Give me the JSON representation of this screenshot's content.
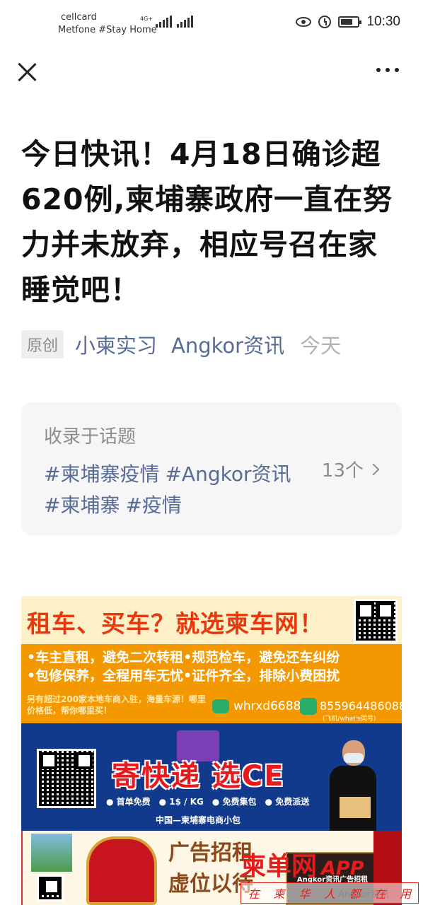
{
  "status_bar": {
    "carrier_line1": "cellcard",
    "carrier_line2": "Metfone #Stay Home",
    "network_label": "4G+",
    "time": "10:30"
  },
  "nav": {
    "close_icon": "close-icon",
    "more_icon": "more-icon"
  },
  "article": {
    "title": "今日快讯！4月18日确诊超620例,柬埔寨政府一直在努力并未放弃，相应号召在家睡觉吧！",
    "badge": "原创",
    "author": "小柬实习",
    "account": "Angkor资讯",
    "date": "今天"
  },
  "topic": {
    "label": "收录于话题",
    "tags": [
      "#柬埔寨疫情",
      "#Angkor资讯",
      "#柬埔寨",
      "#疫情"
    ],
    "count": "13个"
  },
  "ads": {
    "car": {
      "headline": "租车、买车？就选柬车网！",
      "line1": "•车主直租，避免二次转租•规范检车，避免还车纠纷",
      "line2": "•包修保养，全程用车无忧•证件齐全，排除小费困扰",
      "sub": "另有超过200家本地车商入驻，海量车源！哪里价格低，帮你哪里买！",
      "wechat": "whrxd6688",
      "phone": "855964486088",
      "phone_note": "(飞机/what's同号)"
    },
    "express": {
      "headline": "寄快递 选CE",
      "features": [
        "● 首单免费",
        "● 1$ / KG",
        "● 免费集包",
        "● 免费派送"
      ],
      "footer": "中国—柬埔寨电商小包"
    },
    "recruit": {
      "text_line1": "广告招租",
      "text_line2": "虚位以待",
      "box_label": "Angkor资讯广告招租"
    }
  },
  "overlay": {
    "brand": "柬单网",
    "tag": "APP",
    "slogan": [
      "在",
      "柬",
      "华",
      "人",
      "都",
      "在",
      "用"
    ],
    "watermark": "Angkor资讯"
  }
}
